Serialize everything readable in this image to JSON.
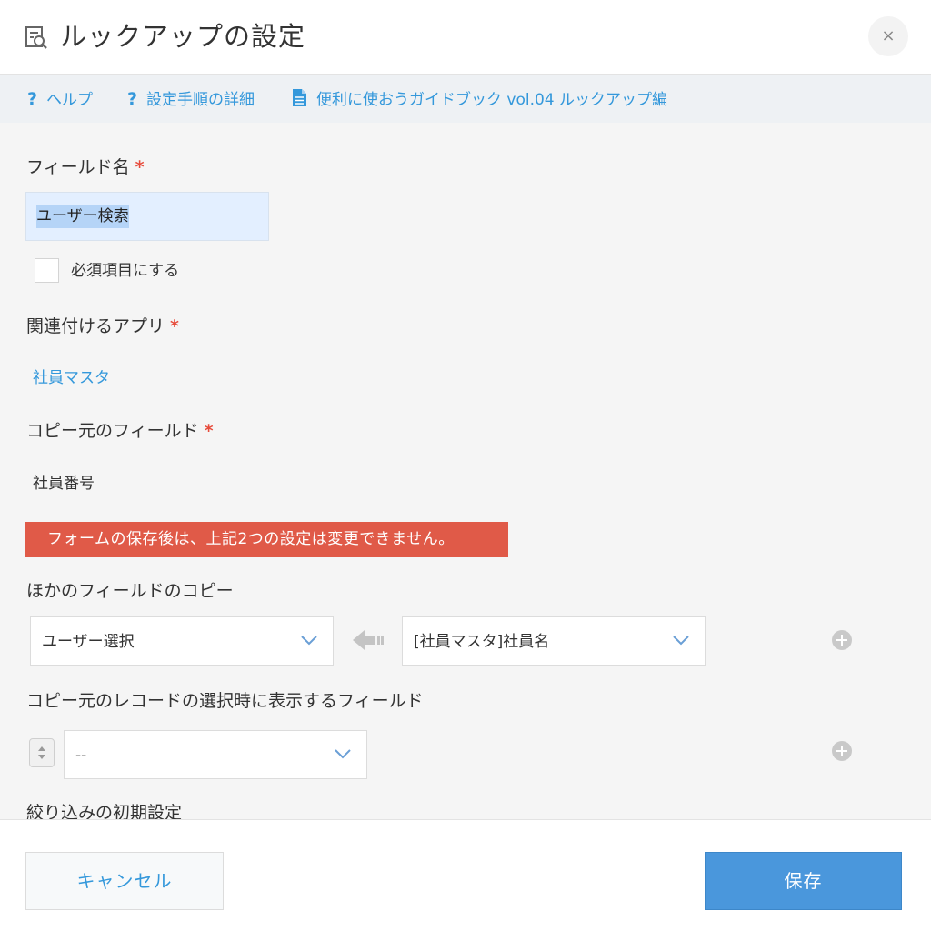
{
  "dialog": {
    "title": "ルックアップの設定",
    "close_label": "×"
  },
  "help_links": {
    "help": "ヘルプ",
    "procedure": "設定手順の詳細",
    "guidebook": "便利に使おうガイドブック vol.04 ルックアップ編",
    "question_mark": "?"
  },
  "form": {
    "field_name": {
      "label": "フィールド名",
      "required_mark": "*",
      "value": "ユーザー検索"
    },
    "required_checkbox": {
      "label": "必須項目にする",
      "checked": false
    },
    "related_app": {
      "label": "関連付けるアプリ",
      "required_mark": "*",
      "value": "社員マスタ"
    },
    "source_field": {
      "label": "コピー元のフィールド",
      "required_mark": "*",
      "value": "社員番号"
    },
    "warning": "フォームの保存後は、上記2つの設定は変更できません。",
    "field_copy": {
      "label": "ほかのフィールドのコピー",
      "target_select": "ユーザー選択",
      "source_select": "[社員マスタ]社員名"
    },
    "display_fields": {
      "label": "コピー元のレコードの選択時に表示するフィールド",
      "select": "--"
    },
    "filter_default": {
      "label": "絞り込みの初期設定"
    }
  },
  "footer": {
    "cancel_label": "キャンセル",
    "save_label": "保存"
  },
  "colors": {
    "accent": "#3498db",
    "required": "#e74c3c",
    "warning_bg": "#e05a48",
    "save_bg": "#4a97dc"
  }
}
